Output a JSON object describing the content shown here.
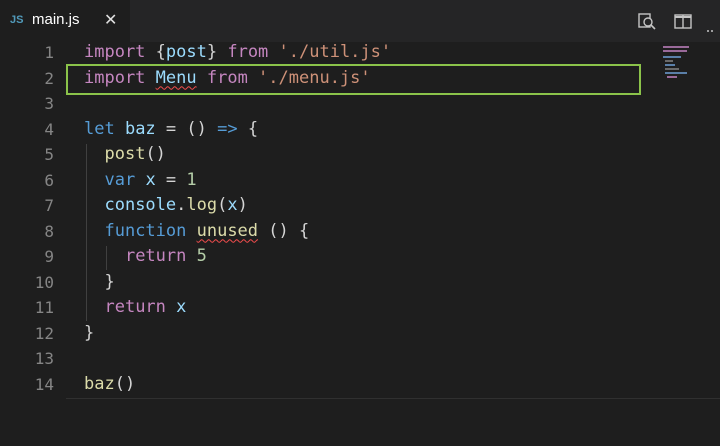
{
  "tab": {
    "language_badge": "JS",
    "filename": "main.js",
    "close_glyph": "✕"
  },
  "toolbar": {
    "icons": [
      "open-changes-icon",
      "split-editor-icon"
    ]
  },
  "editor": {
    "line_numbers": [
      "1",
      "2",
      "3",
      "4",
      "5",
      "6",
      "7",
      "8",
      "9",
      "10",
      "11",
      "12",
      "13",
      "14"
    ],
    "lines": [
      [
        {
          "t": "import ",
          "c": "kw"
        },
        {
          "t": "{",
          "c": "p"
        },
        {
          "t": "post",
          "c": "id"
        },
        {
          "t": "} ",
          "c": "p"
        },
        {
          "t": "from ",
          "c": "kw"
        },
        {
          "t": "'./util.js'",
          "c": "str"
        }
      ],
      [
        {
          "t": "import ",
          "c": "kw"
        },
        {
          "t": "Menu",
          "c": "id",
          "squig": true
        },
        {
          "t": " ",
          "c": "p"
        },
        {
          "t": "from ",
          "c": "kw"
        },
        {
          "t": "'./menu.js'",
          "c": "str"
        }
      ],
      [],
      [
        {
          "t": "let ",
          "c": "kb"
        },
        {
          "t": "baz",
          "c": "id"
        },
        {
          "t": " = () ",
          "c": "p"
        },
        {
          "t": "=>",
          "c": "kb"
        },
        {
          "t": " {",
          "c": "p"
        }
      ],
      [
        {
          "t": "  ",
          "c": "p"
        },
        {
          "t": "post",
          "c": "fn"
        },
        {
          "t": "()",
          "c": "p"
        }
      ],
      [
        {
          "t": "  ",
          "c": "p"
        },
        {
          "t": "var ",
          "c": "kb"
        },
        {
          "t": "x",
          "c": "id"
        },
        {
          "t": " = ",
          "c": "p"
        },
        {
          "t": "1",
          "c": "num"
        }
      ],
      [
        {
          "t": "  ",
          "c": "p"
        },
        {
          "t": "console",
          "c": "id"
        },
        {
          "t": ".",
          "c": "p"
        },
        {
          "t": "log",
          "c": "fn"
        },
        {
          "t": "(",
          "c": "p"
        },
        {
          "t": "x",
          "c": "id"
        },
        {
          "t": ")",
          "c": "p"
        }
      ],
      [
        {
          "t": "  ",
          "c": "p"
        },
        {
          "t": "function ",
          "c": "kb"
        },
        {
          "t": "unused",
          "c": "fn",
          "squig": true
        },
        {
          "t": " () {",
          "c": "p"
        }
      ],
      [
        {
          "t": "    ",
          "c": "p"
        },
        {
          "t": "return ",
          "c": "kw"
        },
        {
          "t": "5",
          "c": "num"
        }
      ],
      [
        {
          "t": "  }",
          "c": "p"
        }
      ],
      [
        {
          "t": "  ",
          "c": "p"
        },
        {
          "t": "return ",
          "c": "kw"
        },
        {
          "t": "x",
          "c": "id"
        }
      ],
      [
        {
          "t": "}",
          "c": "p"
        }
      ],
      [],
      [
        {
          "t": "baz",
          "c": "fn"
        },
        {
          "t": "()",
          "c": "p"
        }
      ]
    ]
  },
  "colors": {
    "highlight_border": "#8bc34a",
    "error_squiggle": "#f14c4c"
  }
}
